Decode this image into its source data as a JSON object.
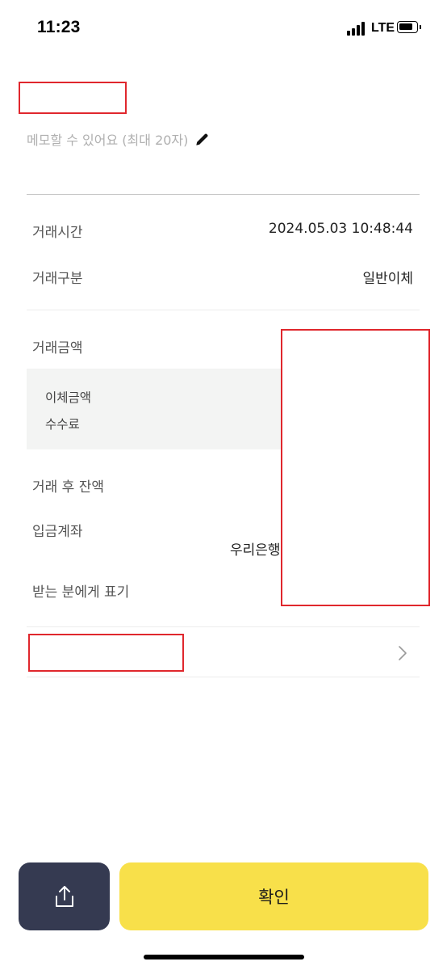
{
  "status_bar": {
    "time": "11:23",
    "network": "LTE"
  },
  "memo": {
    "placeholder": "메모할 수 있어요 (최대 20자)",
    "icon": "pencil-icon"
  },
  "details": {
    "transaction_time_label": "거래시간",
    "transaction_time_value": "2024.05.03 10:48:44",
    "transaction_type_label": "거래구분",
    "transaction_type_value": "일반이체",
    "amount_label": "거래금액",
    "transfer_amount_label": "이체금액",
    "fee_label": "수수료",
    "balance_after_label": "거래 후 잔액",
    "deposit_account_label": "입금계좌",
    "deposit_bank": "우리은행",
    "recipient_display_label": "받는 분에게 표기"
  },
  "buttons": {
    "confirm_label": "확인",
    "share_icon": "share-icon",
    "chevron_icon": "chevron-right-icon"
  },
  "colors": {
    "confirm_bg": "#f8e04a",
    "share_bg": "#353a51",
    "redaction_border": "#e0272d"
  }
}
